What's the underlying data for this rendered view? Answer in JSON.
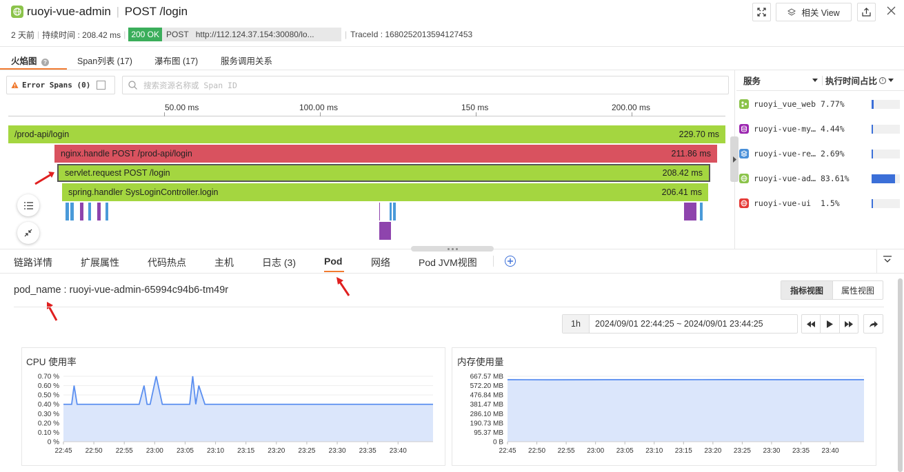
{
  "header": {
    "service": "ruoyi-vue-admin",
    "endpoint": "POST /login",
    "time_ago": "2 天前",
    "duration": "持续时间 : 208.42 ms",
    "status": "200 OK",
    "method": "POST",
    "url": "http://112.124.37.154:30080/lo...",
    "trace_id": "TraceId : 1680252013594127453",
    "related_view": "相关 View"
  },
  "top_tabs": [
    "火焰图",
    "Span列表 (17)",
    "瀑布图 (17)",
    "服务调用关系"
  ],
  "filter": {
    "error_spans": "Error Spans (0)",
    "search_placeholder": "搜索资源名称或 Span ID"
  },
  "ruler": [
    "50.00 ms",
    "100.00 ms",
    "150 ms",
    "200.00 ms"
  ],
  "spans": [
    {
      "name": "/prod-api/login",
      "duration": "229.70 ms",
      "color": "#a4d640"
    },
    {
      "name": "nginx.handle POST /prod-api/login",
      "duration": "211.86 ms",
      "color": "#d9525f"
    },
    {
      "name": "servlet.request POST /login",
      "duration": "208.42 ms",
      "color": "#a4d640"
    },
    {
      "name": "spring.handler SysLoginController.login",
      "duration": "206.41 ms",
      "color": "#a4d640"
    }
  ],
  "services_panel": {
    "col_service": "服务",
    "col_ratio": "执行时间占比",
    "rows": [
      {
        "name": "ruoyi_vue_web",
        "percent": "7.77%",
        "ratio": 0.0777,
        "color": "#8bc34a",
        "icon": "web-icon"
      },
      {
        "name": "ruoyi-vue-my…",
        "percent": "4.44%",
        "ratio": 0.0444,
        "color": "#9c27b0",
        "icon": "database-icon"
      },
      {
        "name": "ruoyi-vue-re…",
        "percent": "2.69%",
        "ratio": 0.0269,
        "color": "#4a90d9",
        "icon": "layers-icon"
      },
      {
        "name": "ruoyi-vue-ad…",
        "percent": "83.61%",
        "ratio": 0.8361,
        "color": "#8bc34a",
        "icon": "globe-icon"
      },
      {
        "name": "ruoyi-vue-ui",
        "percent": "1.5%",
        "ratio": 0.015,
        "color": "#e53935",
        "icon": "globe-icon"
      }
    ]
  },
  "detail_tabs": [
    "链路详情",
    "扩展属性",
    "代码热点",
    "主机",
    "日志 (3)",
    "Pod",
    "网络",
    "Pod JVM视图"
  ],
  "pod": {
    "pod_name": "pod_name : ruoyi-vue-admin-65994c94b6-tm49r",
    "view_metric": "指标视图",
    "view_attr": "属性视图",
    "range_btn": "1h",
    "range_text": "2024/09/01 22:44:25 ~ 2024/09/01 23:44:25"
  },
  "chart_data": [
    {
      "type": "area",
      "title": "CPU 使用率",
      "x": [
        "22:45",
        "22:50",
        "22:55",
        "23:00",
        "23:05",
        "23:10",
        "23:15",
        "23:20",
        "23:25",
        "23:30",
        "23:35",
        "23:40"
      ],
      "yticks": [
        "0.70 %",
        "0.60 %",
        "0.50 %",
        "0.40 %",
        "0.30 %",
        "0.20 %",
        "0.10 %",
        "0 %"
      ],
      "ylim": [
        0,
        0.7
      ],
      "points_t": [
        22.75,
        23.3,
        23.75,
        24.1,
        24.5,
        25,
        25.5,
        26,
        26.5,
        27,
        28,
        28.5,
        29,
        29.5,
        30,
        30.5,
        31,
        32,
        33,
        34,
        35.2,
        36,
        36.5,
        37,
        38,
        39,
        40,
        41,
        42,
        43,
        43.5,
        44,
        44.5,
        45,
        46,
        47,
        48,
        50,
        55,
        60,
        65,
        70,
        75,
        80,
        83.5
      ],
      "values": [
        0.4,
        0.4,
        0.4,
        0.4,
        0.6,
        0.4,
        0.4,
        0.4,
        0.4,
        0.4,
        0.4,
        0.4,
        0.4,
        0.4,
        0.4,
        0.4,
        0.4,
        0.4,
        0.4,
        0.4,
        0.4,
        0.6,
        0.4,
        0.4,
        0.7,
        0.4,
        0.4,
        0.4,
        0.4,
        0.4,
        0.4,
        0.7,
        0.4,
        0.6,
        0.4,
        0.4,
        0.4,
        0.4,
        0.4,
        0.4,
        0.4,
        0.4,
        0.4,
        0.4,
        0.4
      ]
    },
    {
      "type": "area",
      "title": "内存使用量",
      "x": [
        "22:45",
        "22:50",
        "22:55",
        "23:00",
        "23:05",
        "23:10",
        "23:15",
        "23:20",
        "23:25",
        "23:30",
        "23:35",
        "23:40"
      ],
      "yticks": [
        "667.57 MB",
        "572.20 MB",
        "476.84 MB",
        "381.47 MB",
        "286.10 MB",
        "190.73 MB",
        "95.37 MB",
        "0 B"
      ],
      "ylim": [
        0,
        667.57
      ],
      "points_t": [
        22.75,
        30,
        40,
        50,
        60,
        70,
        83.5
      ],
      "values": [
        632,
        631,
        632,
        632,
        633,
        632,
        632
      ]
    }
  ]
}
